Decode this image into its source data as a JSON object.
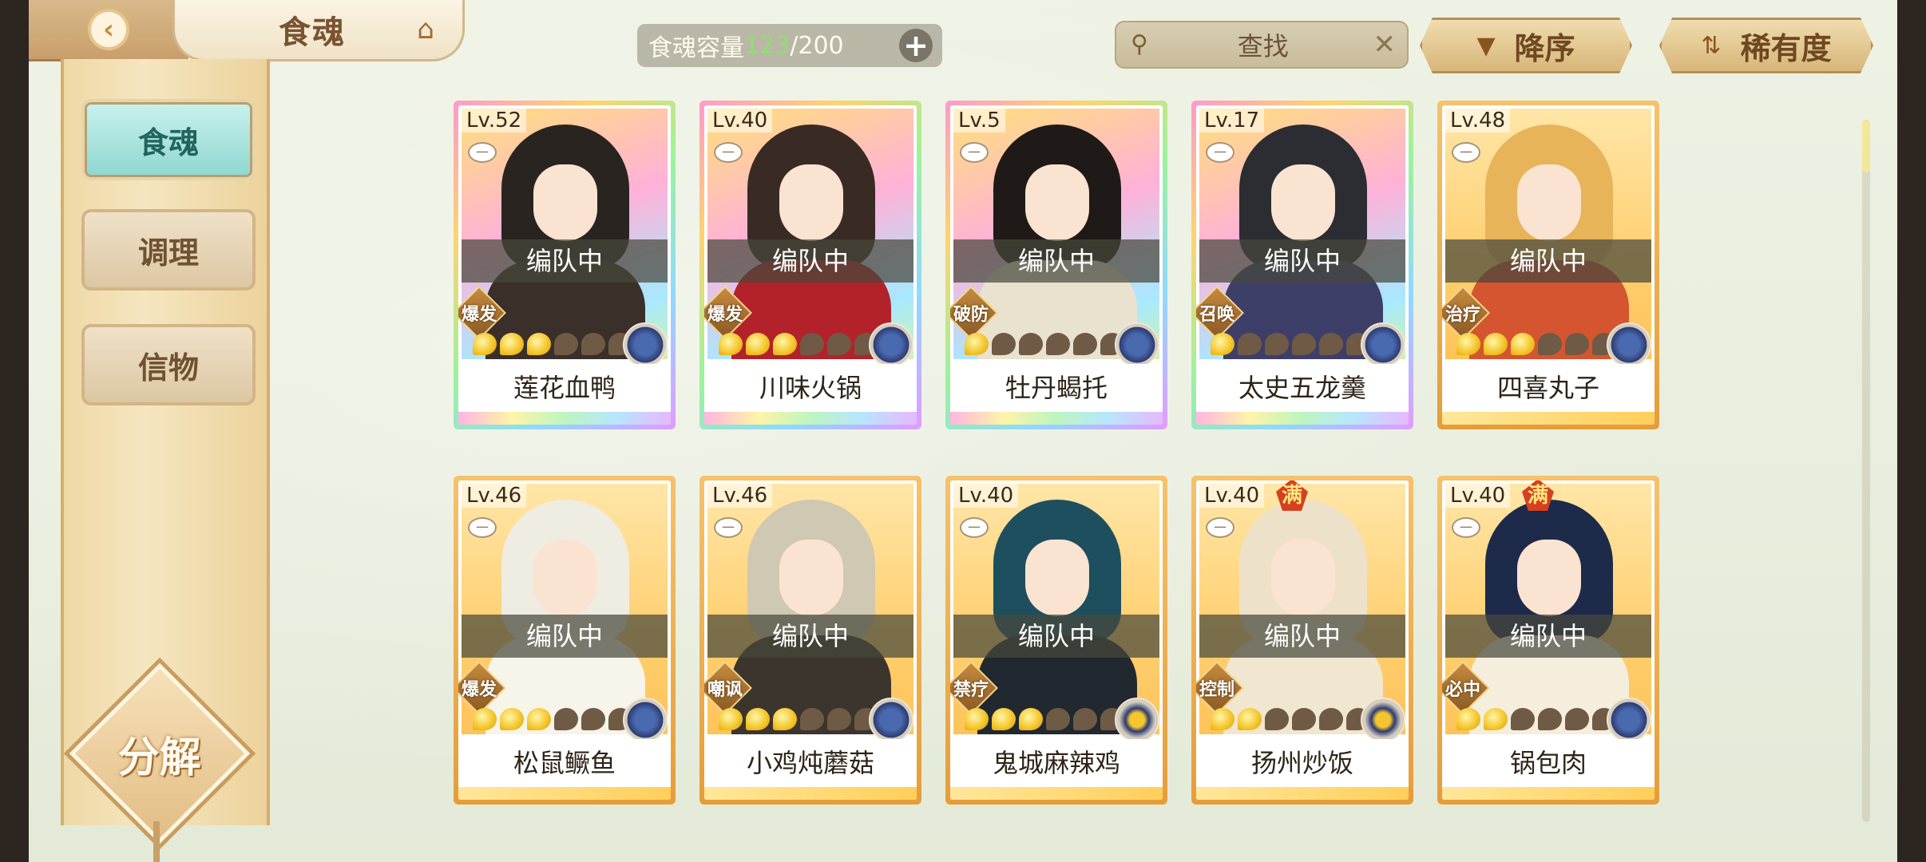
{
  "header": {
    "title": "食魂",
    "back_icon": "chevron-left-icon",
    "home_icon": "pavilion-icon",
    "capacity": {
      "label": "食魂容量",
      "current": "123",
      "separator": "/",
      "max": "200",
      "add_icon": "plus-icon",
      "current_color": "#8ee06e"
    },
    "search": {
      "placeholder": "查找",
      "icon": "magnifier-icon",
      "clear_icon": "close-icon"
    },
    "sort_order": {
      "label": "降序",
      "icon": "triangle-down-icon"
    },
    "sort_key": {
      "label": "稀有度",
      "icon": "sort-arrows-icon"
    }
  },
  "sidebar": {
    "tabs": [
      {
        "label": "食魂",
        "active": true
      },
      {
        "label": "调理",
        "active": false
      },
      {
        "label": "信物",
        "active": false
      }
    ],
    "decompose_label": "分解"
  },
  "cards": [
    {
      "level": "Lv.52",
      "name": "莲花血鸭",
      "status": "编队中",
      "role": "爆发",
      "stars_on": 3,
      "stars_total": 6,
      "frame": "rainbow",
      "full": false,
      "hair": "#2a2420",
      "outfit": "#3b2f2a"
    },
    {
      "level": "Lv.40",
      "name": "川味火锅",
      "status": "编队中",
      "role": "爆发",
      "stars_on": 3,
      "stars_total": 6,
      "frame": "rainbow",
      "full": false,
      "hair": "#3a2a24",
      "outfit": "#b3222a"
    },
    {
      "level": "Lv.5",
      "name": "牡丹蝎托",
      "status": "编队中",
      "role": "破防",
      "stars_on": 1,
      "stars_total": 6,
      "frame": "rainbow",
      "full": false,
      "hair": "#1f1a18",
      "outfit": "#e9e2cf"
    },
    {
      "level": "Lv.17",
      "name": "太史五龙羹",
      "status": "编队中",
      "role": "召唤",
      "stars_on": 1,
      "stars_total": 6,
      "frame": "rainbow",
      "full": false,
      "hair": "#2b2d33",
      "outfit": "#3e3f68"
    },
    {
      "level": "Lv.48",
      "name": "四喜丸子",
      "status": "编队中",
      "role": "治疗",
      "stars_on": 3,
      "stars_total": 6,
      "frame": "gold",
      "full": false,
      "hair": "#e7b45a",
      "outfit": "#d4552f"
    },
    {
      "level": "Lv.46",
      "name": "松鼠鳜鱼",
      "status": "编队中",
      "role": "爆发",
      "stars_on": 3,
      "stars_total": 6,
      "frame": "gold",
      "full": false,
      "hair": "#efece2",
      "outfit": "#f7f4ea"
    },
    {
      "level": "Lv.46",
      "name": "小鸡炖蘑菇",
      "status": "编队中",
      "role": "嘲讽",
      "stars_on": 3,
      "stars_total": 6,
      "frame": "gold",
      "full": false,
      "hair": "#cfc8b2",
      "outfit": "#3c352d"
    },
    {
      "level": "Lv.40",
      "name": "鬼城麻辣鸡",
      "status": "编队中",
      "role": "禁疗",
      "stars_on": 3,
      "stars_total": 6,
      "frame": "gold",
      "full": false,
      "hair": "#1d4f5e",
      "outfit": "#22282f"
    },
    {
      "level": "Lv.40",
      "name": "扬州炒饭",
      "status": "编队中",
      "role": "控制",
      "stars_on": 2,
      "stars_total": 6,
      "frame": "gold",
      "full": true,
      "full_label": "满",
      "hair": "#eee1c9",
      "outfit": "#f1e6cf"
    },
    {
      "level": "Lv.40",
      "name": "锅包肉",
      "status": "编队中",
      "role": "必中",
      "stars_on": 2,
      "stars_total": 6,
      "frame": "gold",
      "full": true,
      "full_label": "满",
      "hair": "#1d2a4a",
      "outfit": "#f5eedd"
    }
  ]
}
